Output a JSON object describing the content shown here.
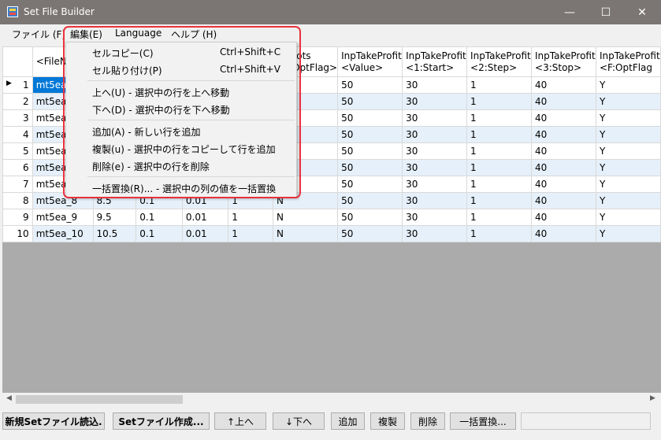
{
  "window": {
    "title": "Set File Builder",
    "minimize": "—",
    "maximize": "☐",
    "close": "✕"
  },
  "menubar": {
    "file": "ファイル (F)",
    "edit": "編集(E)",
    "language": "Language",
    "help": "ヘルプ (H)"
  },
  "columns": [
    "<FileN",
    "",
    "",
    "",
    "",
    "InpLots\n<F:OptFlag>",
    "InpTakeProfit\n<Value>",
    "InpTakeProfit\n<1:Start>",
    "InpTakeProfit\n<2:Step>",
    "InpTakeProfit\n<3:Stop>",
    "InpTakeProfit\n<F:OptFlag"
  ],
  "rows": [
    {
      "num": "1",
      "c": [
        "mt5ea",
        "",
        "",
        "",
        "",
        "",
        "50",
        "30",
        "1",
        "40",
        "Y"
      ]
    },
    {
      "num": "2",
      "c": [
        "mt5ea",
        "",
        "",
        "",
        "",
        "",
        "50",
        "30",
        "1",
        "40",
        "Y"
      ]
    },
    {
      "num": "3",
      "c": [
        "mt5ea",
        "",
        "",
        "",
        "",
        "",
        "50",
        "30",
        "1",
        "40",
        "Y"
      ]
    },
    {
      "num": "4",
      "c": [
        "mt5ea",
        "",
        "",
        "",
        "",
        "",
        "50",
        "30",
        "1",
        "40",
        "Y"
      ]
    },
    {
      "num": "5",
      "c": [
        "mt5ea",
        "",
        "",
        "",
        "",
        "",
        "50",
        "30",
        "1",
        "40",
        "Y"
      ]
    },
    {
      "num": "6",
      "c": [
        "mt5ea",
        "",
        "",
        "",
        "",
        "",
        "50",
        "30",
        "1",
        "40",
        "Y"
      ]
    },
    {
      "num": "7",
      "c": [
        "mt5ea",
        "",
        "",
        "",
        "",
        "",
        "50",
        "30",
        "1",
        "40",
        "Y"
      ]
    },
    {
      "num": "8",
      "c": [
        "mt5ea_8",
        "8.5",
        "0.1",
        "0.01",
        "1",
        "N",
        "50",
        "30",
        "1",
        "40",
        "Y"
      ]
    },
    {
      "num": "9",
      "c": [
        "mt5ea_9",
        "9.5",
        "0.1",
        "0.01",
        "1",
        "N",
        "50",
        "30",
        "1",
        "40",
        "Y"
      ]
    },
    {
      "num": "10",
      "c": [
        "mt5ea_10",
        "10.5",
        "0.1",
        "0.01",
        "1",
        "N",
        "50",
        "30",
        "1",
        "40",
        "Y"
      ]
    }
  ],
  "edit_menu": {
    "cell_copy": "セルコピー(C)",
    "cell_copy_key": "Ctrl+Shift+C",
    "cell_paste": "セル貼り付け(P)",
    "cell_paste_key": "Ctrl+Shift+V",
    "move_up": "上へ(U) - 選択中の行を上へ移動",
    "move_down": "下へ(D) - 選択中の行を下へ移動",
    "add": "追加(A) - 新しい行を追加",
    "duplicate": "複製(u) - 選択中の行をコピーして行を追加",
    "delete": "削除(e) - 選択中の行を削除",
    "replace": "一括置換(R)... - 選択中の列の値を一括置換"
  },
  "buttons": {
    "load": "新規Setファイル読込.",
    "create": "Setファイル作成...",
    "up": "↑上へ",
    "down": "↓下へ",
    "add": "追加",
    "duplicate": "複製",
    "delete": "削除",
    "replace": "一括置換..."
  },
  "colors": {
    "titlebar": "#7b7673",
    "selection": "#0078d7",
    "highlight": "#e8323c",
    "alt_row": "#e6f0fa"
  }
}
